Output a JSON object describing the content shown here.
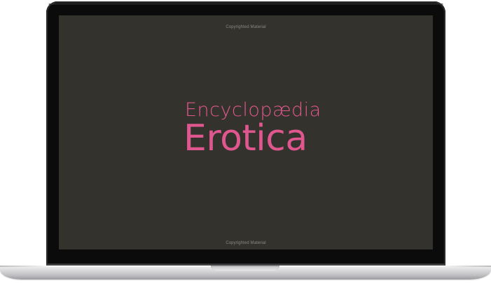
{
  "device": {
    "type": "laptop",
    "bezel_color": "#0b0b0b",
    "body_color": "#d9d9db"
  },
  "screen": {
    "background_color": "#33322c",
    "watermark_top": "Copyrighted Material",
    "watermark_bottom": "Copyrighted Material",
    "title_line1": "Encyclopædia",
    "title_line2": "Erotica",
    "title_color": "#e0578f"
  }
}
